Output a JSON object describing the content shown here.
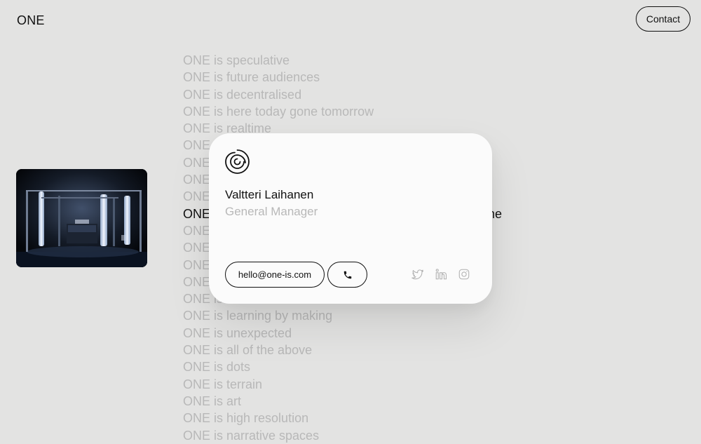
{
  "header": {
    "logo": "ONE",
    "contact_label": "Contact"
  },
  "statements": [
    {
      "text": "ONE is speculative"
    },
    {
      "text": "ONE is future audiences"
    },
    {
      "text": "ONE is decentralised"
    },
    {
      "text": "ONE is here today gone tomorrow"
    },
    {
      "text": "ONE is realtime"
    },
    {
      "text": "ONE"
    },
    {
      "text": "ONE"
    },
    {
      "text": "ONE"
    },
    {
      "text": "ONE"
    },
    {
      "text": "ONE",
      "tail": "hine",
      "active": true
    },
    {
      "text": "ONE"
    },
    {
      "text": "ONE"
    },
    {
      "text": "ONE"
    },
    {
      "text": "ONE"
    },
    {
      "text": "ONE is"
    },
    {
      "text": "ONE is learning by making"
    },
    {
      "text": "ONE is unexpected"
    },
    {
      "text": "ONE is all of the above"
    },
    {
      "text": "ONE is dots"
    },
    {
      "text": "ONE is terrain"
    },
    {
      "text": "ONE is art"
    },
    {
      "text": "ONE is high resolution"
    },
    {
      "text": "ONE is narrative spaces"
    }
  ],
  "card": {
    "name": "Valtteri Laihanen",
    "role": "General Manager",
    "email": "hello@one-is.com",
    "icons": {
      "logo": "swirl-logo-icon",
      "phone": "phone-icon",
      "twitter": "twitter-icon",
      "linkedin": "linkedin-icon",
      "instagram": "instagram-icon"
    }
  },
  "colors": {
    "background": "#e3e3e2",
    "text": "#111111",
    "muted": "#b8b8b8",
    "card": "#fbfbfb",
    "social_icon": "#b0b0b0"
  }
}
